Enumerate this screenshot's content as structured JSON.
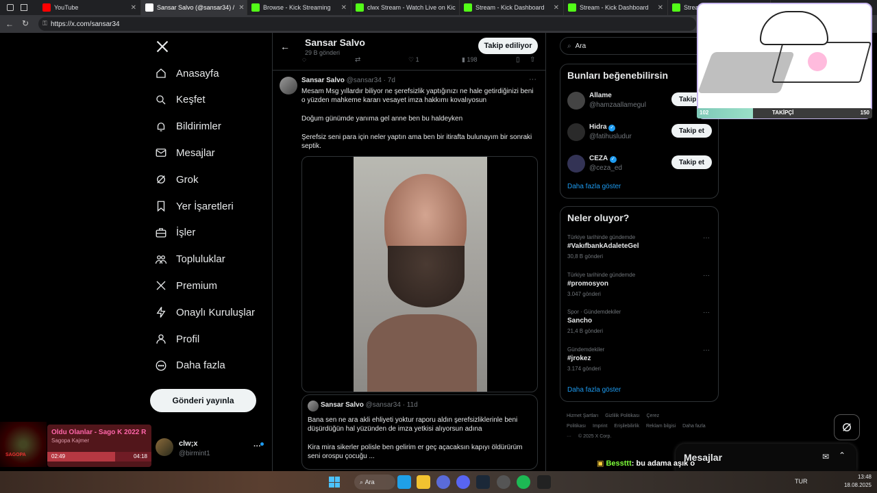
{
  "browser": {
    "tabs": [
      {
        "title": "YouTube",
        "fav_color": "#ff0000"
      },
      {
        "title": "Sansar Salvo (@sansar34) /",
        "fav_color": "#ffffff"
      },
      {
        "title": "Browse - Kick Streaming",
        "fav_color": "#53fc18"
      },
      {
        "title": "clwx Stream - Watch Live on Kic",
        "fav_color": "#53fc18"
      },
      {
        "title": "Stream - Kick Dashboard",
        "fav_color": "#53fc18"
      },
      {
        "title": "Stream - Kick Dashboard",
        "fav_color": "#53fc18"
      },
      {
        "title": "Stream - Kick Dashboard",
        "fav_color": "#53fc18"
      }
    ],
    "url": "https://x.com/sansar34"
  },
  "sidebar": {
    "items": [
      {
        "label": "Anasayfa",
        "icon": "home-icon"
      },
      {
        "label": "Keşfet",
        "icon": "search-icon"
      },
      {
        "label": "Bildirimler",
        "icon": "bell-icon"
      },
      {
        "label": "Mesajlar",
        "icon": "mail-icon"
      },
      {
        "label": "Grok",
        "icon": "grok-icon"
      },
      {
        "label": "Yer İşaretleri",
        "icon": "bookmark-icon"
      },
      {
        "label": "İşler",
        "icon": "briefcase-icon"
      },
      {
        "label": "Topluluklar",
        "icon": "people-icon"
      },
      {
        "label": "Premium",
        "icon": "x-logo-icon"
      },
      {
        "label": "Onaylı Kuruluşlar",
        "icon": "lightning-icon"
      },
      {
        "label": "Profil",
        "icon": "person-icon"
      },
      {
        "label": "Daha fazla",
        "icon": "more-circle-icon"
      }
    ],
    "post_button": "Gönderi yayınla",
    "account": {
      "name": "clw;x",
      "handle": "@birmint1"
    }
  },
  "profile_header": {
    "name": "Sansar Salvo",
    "posts_count": "29 B gönderi",
    "follow_label": "Takip ediliyor"
  },
  "prev_actions": {
    "likes": "1",
    "views": "198"
  },
  "tweet": {
    "name": "Sansar Salvo",
    "handle": "@sansar34",
    "time": "· 7d",
    "text1": "Mesam Msg yıllardır biliyor ne şerefsizlik yaptığınızı ne hale getirdiğinizi beni o yüzden mahkeme kararı vesayet imza hakkımı kovalıyosun",
    "text2": "Doğum günümde yanıma gel anne ben bu haldeyken",
    "text3": "Şerefsiz seni para için neler yaptın ama ben bir itirafta bulunayım bir sonraki septik."
  },
  "quote": {
    "name": "Sansar Salvo",
    "handle": "@sansar34",
    "time": "· 11d",
    "text1": "Bana sen ne ara akli ehliyeti yoktur raporu aldın şerefsizliklerinle beni düşürdüğün hal yüzünden de imza yetkisi alıyorsun adına",
    "text2": "Kira mira sikerler polisle ben gelirim er geç açacaksın kapıyı öldürürüm seni orospu çocuğu ..."
  },
  "search": {
    "placeholder": "Ara"
  },
  "suggestions": {
    "title": "Bunları beğenebilirsin",
    "follow_label": "Takip et",
    "users": [
      {
        "name": "Allame",
        "handle": "@hamzaallamegul",
        "verified": false
      },
      {
        "name": "Hidra",
        "handle": "@fatihusludur",
        "verified": true
      },
      {
        "name": "CEZA",
        "handle": "@ceza_ed",
        "verified": true
      }
    ],
    "show_more": "Daha fazla göster"
  },
  "trends": {
    "title": "Neler oluyor?",
    "items": [
      {
        "context": "Türkiye tarihinde gündemde",
        "name": "#VakıfbankAdaleteGel",
        "count": "30,8 B gönderi"
      },
      {
        "context": "Türkiye tarihinde gündemde",
        "name": "#promosyon",
        "count": "3.047 gönderi"
      },
      {
        "context": "Spor · Gündemdekiler",
        "name": "Sancho",
        "count": "21,4 B gönderi"
      },
      {
        "context": "Gündemdekiler",
        "name": "#jrokez",
        "count": "3.174 gönderi"
      }
    ],
    "show_more": "Daha fazla göster"
  },
  "footer": {
    "links": [
      "Hizmet Şartları",
      "Gizlilik Politikası",
      "Çerez Politikası",
      "Imprint",
      "Erişilebilirlik",
      "Reklam bilgisi",
      "Daha fazla ···",
      "© 2025 X Corp."
    ]
  },
  "messages_panel": {
    "title": "Mesajlar"
  },
  "overlay": {
    "followers_current": "102",
    "followers_label": "TAKİPÇİ",
    "followers_goal": "150",
    "progress_fraction": 0.32,
    "chat_user": "Bessttt",
    "chat_text": ": bu adama aşık o"
  },
  "music_widget": {
    "title": "Oldu Olanlar - Sago K 2022 R",
    "artist": "Sagopa Kajmer",
    "time_current": "02:49",
    "time_total": "04:18",
    "progress_fraction": 0.65
  },
  "taskbar": {
    "search_label": "Ara",
    "lang": "TUR",
    "time": "13:48",
    "date": "18.08.2025"
  }
}
